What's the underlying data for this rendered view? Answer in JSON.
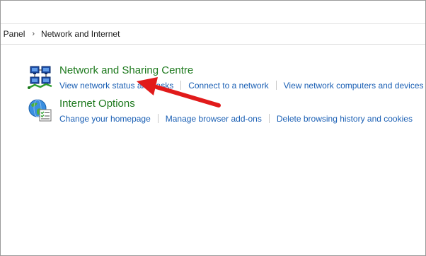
{
  "breadcrumb": [
    "ol Panel",
    "Network and Internet"
  ],
  "sections": [
    {
      "title": "Network and Sharing Centre",
      "icon": "network-sharing-icon",
      "links": [
        "View network status and tasks",
        "Connect to a network",
        "View network computers and devices"
      ]
    },
    {
      "title": "Internet Options",
      "icon": "internet-options-icon",
      "links": [
        "Change your homepage",
        "Manage browser add-ons",
        "Delete browsing history and cookies"
      ]
    }
  ],
  "colors": {
    "title_green": "#1e7a1e",
    "link_blue": "#1a5fb4",
    "arrow_red": "#e11a1a"
  }
}
